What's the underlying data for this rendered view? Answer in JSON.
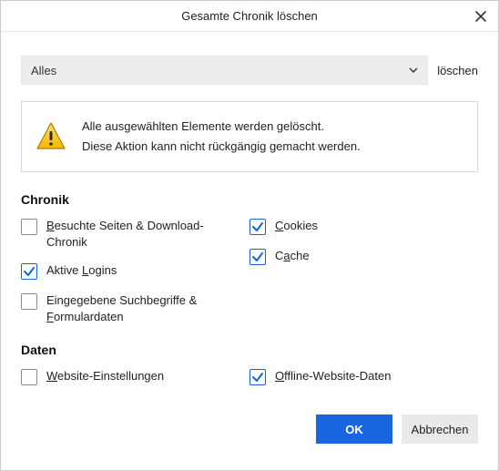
{
  "dialog": {
    "title": "Gesamte Chronik löschen"
  },
  "range": {
    "selected": "Alles",
    "suffix": "löschen"
  },
  "warning": {
    "line1": "Alle ausgewählten Elemente werden gelöscht.",
    "line2": "Diese Aktion kann nicht rückgängig gemacht werden."
  },
  "sections": {
    "chronik": "Chronik",
    "daten": "Daten"
  },
  "items": {
    "visited": {
      "prefix": "",
      "accel": "B",
      "rest": "esuchte Seiten & Download-Chronik",
      "checked": false
    },
    "logins": {
      "prefix": "Aktive ",
      "accel": "L",
      "rest": "ogins",
      "checked": true
    },
    "forms": {
      "prefix": "Eingegebene Suchbegriffe & ",
      "accel": "F",
      "rest": "ormulardaten",
      "checked": false
    },
    "cookies": {
      "prefix": "",
      "accel": "C",
      "rest": "ookies",
      "checked": true
    },
    "cache": {
      "prefix": "C",
      "accel": "a",
      "rest": "che",
      "checked": true
    },
    "site": {
      "prefix": "",
      "accel": "W",
      "rest": "ebsite-Einstellungen",
      "checked": false
    },
    "offline": {
      "prefix": "",
      "accel": "O",
      "rest": "ffline-Website-Daten",
      "checked": true
    }
  },
  "buttons": {
    "ok": "OK",
    "cancel": "Abbrechen"
  }
}
